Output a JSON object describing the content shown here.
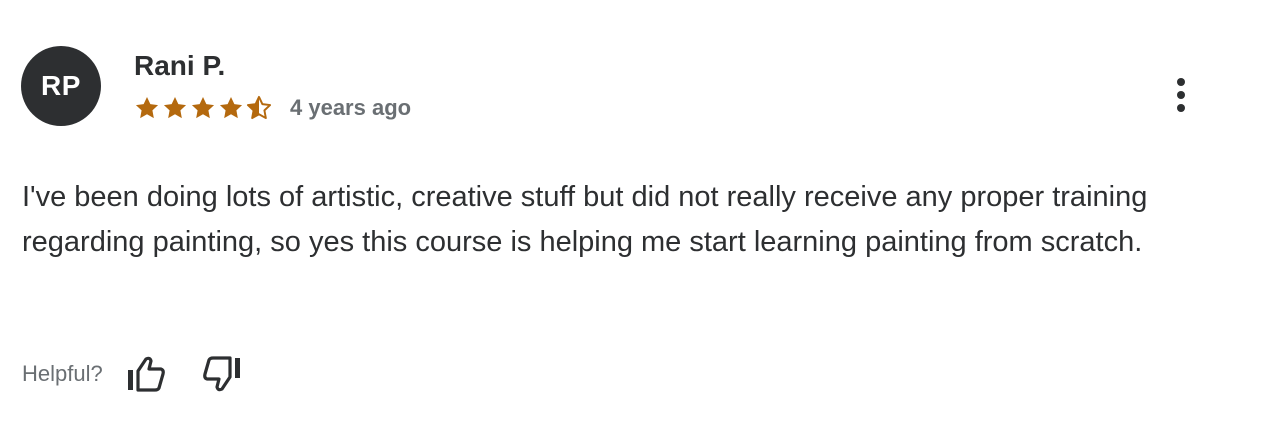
{
  "reviewer": {
    "initials": "RP",
    "name": "Rani P."
  },
  "rating": {
    "value": 4.5,
    "max": 5,
    "star_color": "#b4690e"
  },
  "time_ago": "4 years ago",
  "review_text": "I've been doing lots of artistic, creative stuff but did not really receive any proper training regarding painting, so yes this course is helping me start learning painting from scratch.",
  "helpful": {
    "label": "Helpful?"
  },
  "icons": {
    "more": "more-vertical-icon",
    "thumbs_up": "thumbs-up-icon",
    "thumbs_down": "thumbs-down-icon",
    "star": "star-icon"
  },
  "colors": {
    "text": "#2d2f31",
    "muted": "#6a6f73",
    "avatar_bg": "#2d2f31"
  }
}
